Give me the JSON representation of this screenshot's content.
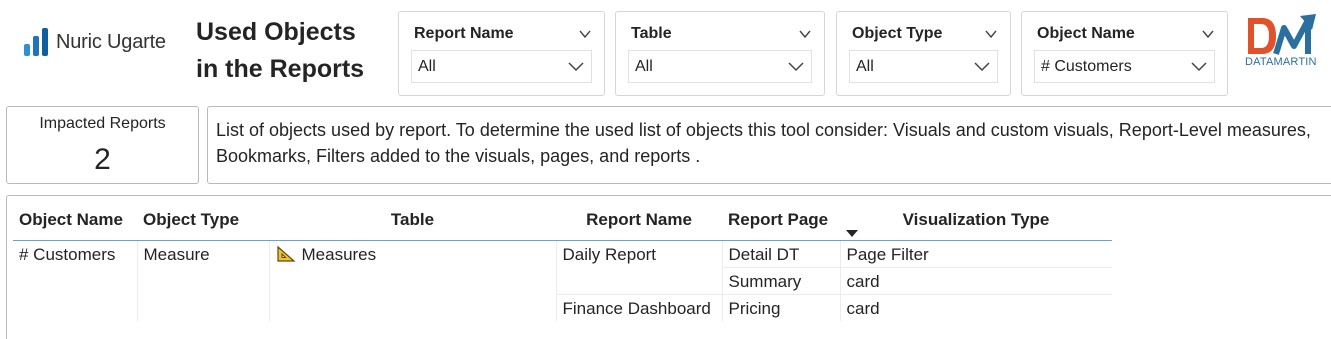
{
  "brand": {
    "name": "Nuric Ugarte"
  },
  "title": {
    "line1": "Used Objects",
    "line2": "in the Reports"
  },
  "slicers": [
    {
      "label": "Report Name",
      "value": "All"
    },
    {
      "label": "Table",
      "value": "All"
    },
    {
      "label": "Object Type",
      "value": "All"
    },
    {
      "label": "Object Name",
      "value": "# Customers"
    }
  ],
  "logo_right": {
    "text": "DATAMARTIN"
  },
  "kpi": {
    "label": "Impacted Reports",
    "value": "2"
  },
  "description": "List of objects used by report. To determine the used list of objects this tool consider: Visuals and custom visuals, Report-Level measures, Bookmarks, Filters added to the visuals, pages, and reports .",
  "table": {
    "headers": [
      "Object Name",
      "Object Type",
      "Table",
      "Report Name",
      "Report Page",
      "Visualization Type"
    ],
    "sorted_column": "Visualization Type",
    "rows": [
      {
        "object_name": "# Customers",
        "object_type": "Measure",
        "table_icon": "measures-table-icon",
        "table": "Measures",
        "report_name": "Daily Report",
        "report_page": "Detail DT",
        "visualization_type": "Page Filter"
      },
      {
        "object_name": "",
        "object_type": "",
        "table": "",
        "report_name": "",
        "report_page": "Summary",
        "visualization_type": "card"
      },
      {
        "object_name": "",
        "object_type": "",
        "table": "",
        "report_name": "Finance Dashboard",
        "report_page": "Pricing",
        "visualization_type": "card"
      }
    ]
  },
  "colors": {
    "brand_blue": "#1f73b8",
    "datamartin_orange": "#e0522b",
    "datamartin_blue": "#2a6f9e",
    "header_underline": "#6aa3d1"
  }
}
